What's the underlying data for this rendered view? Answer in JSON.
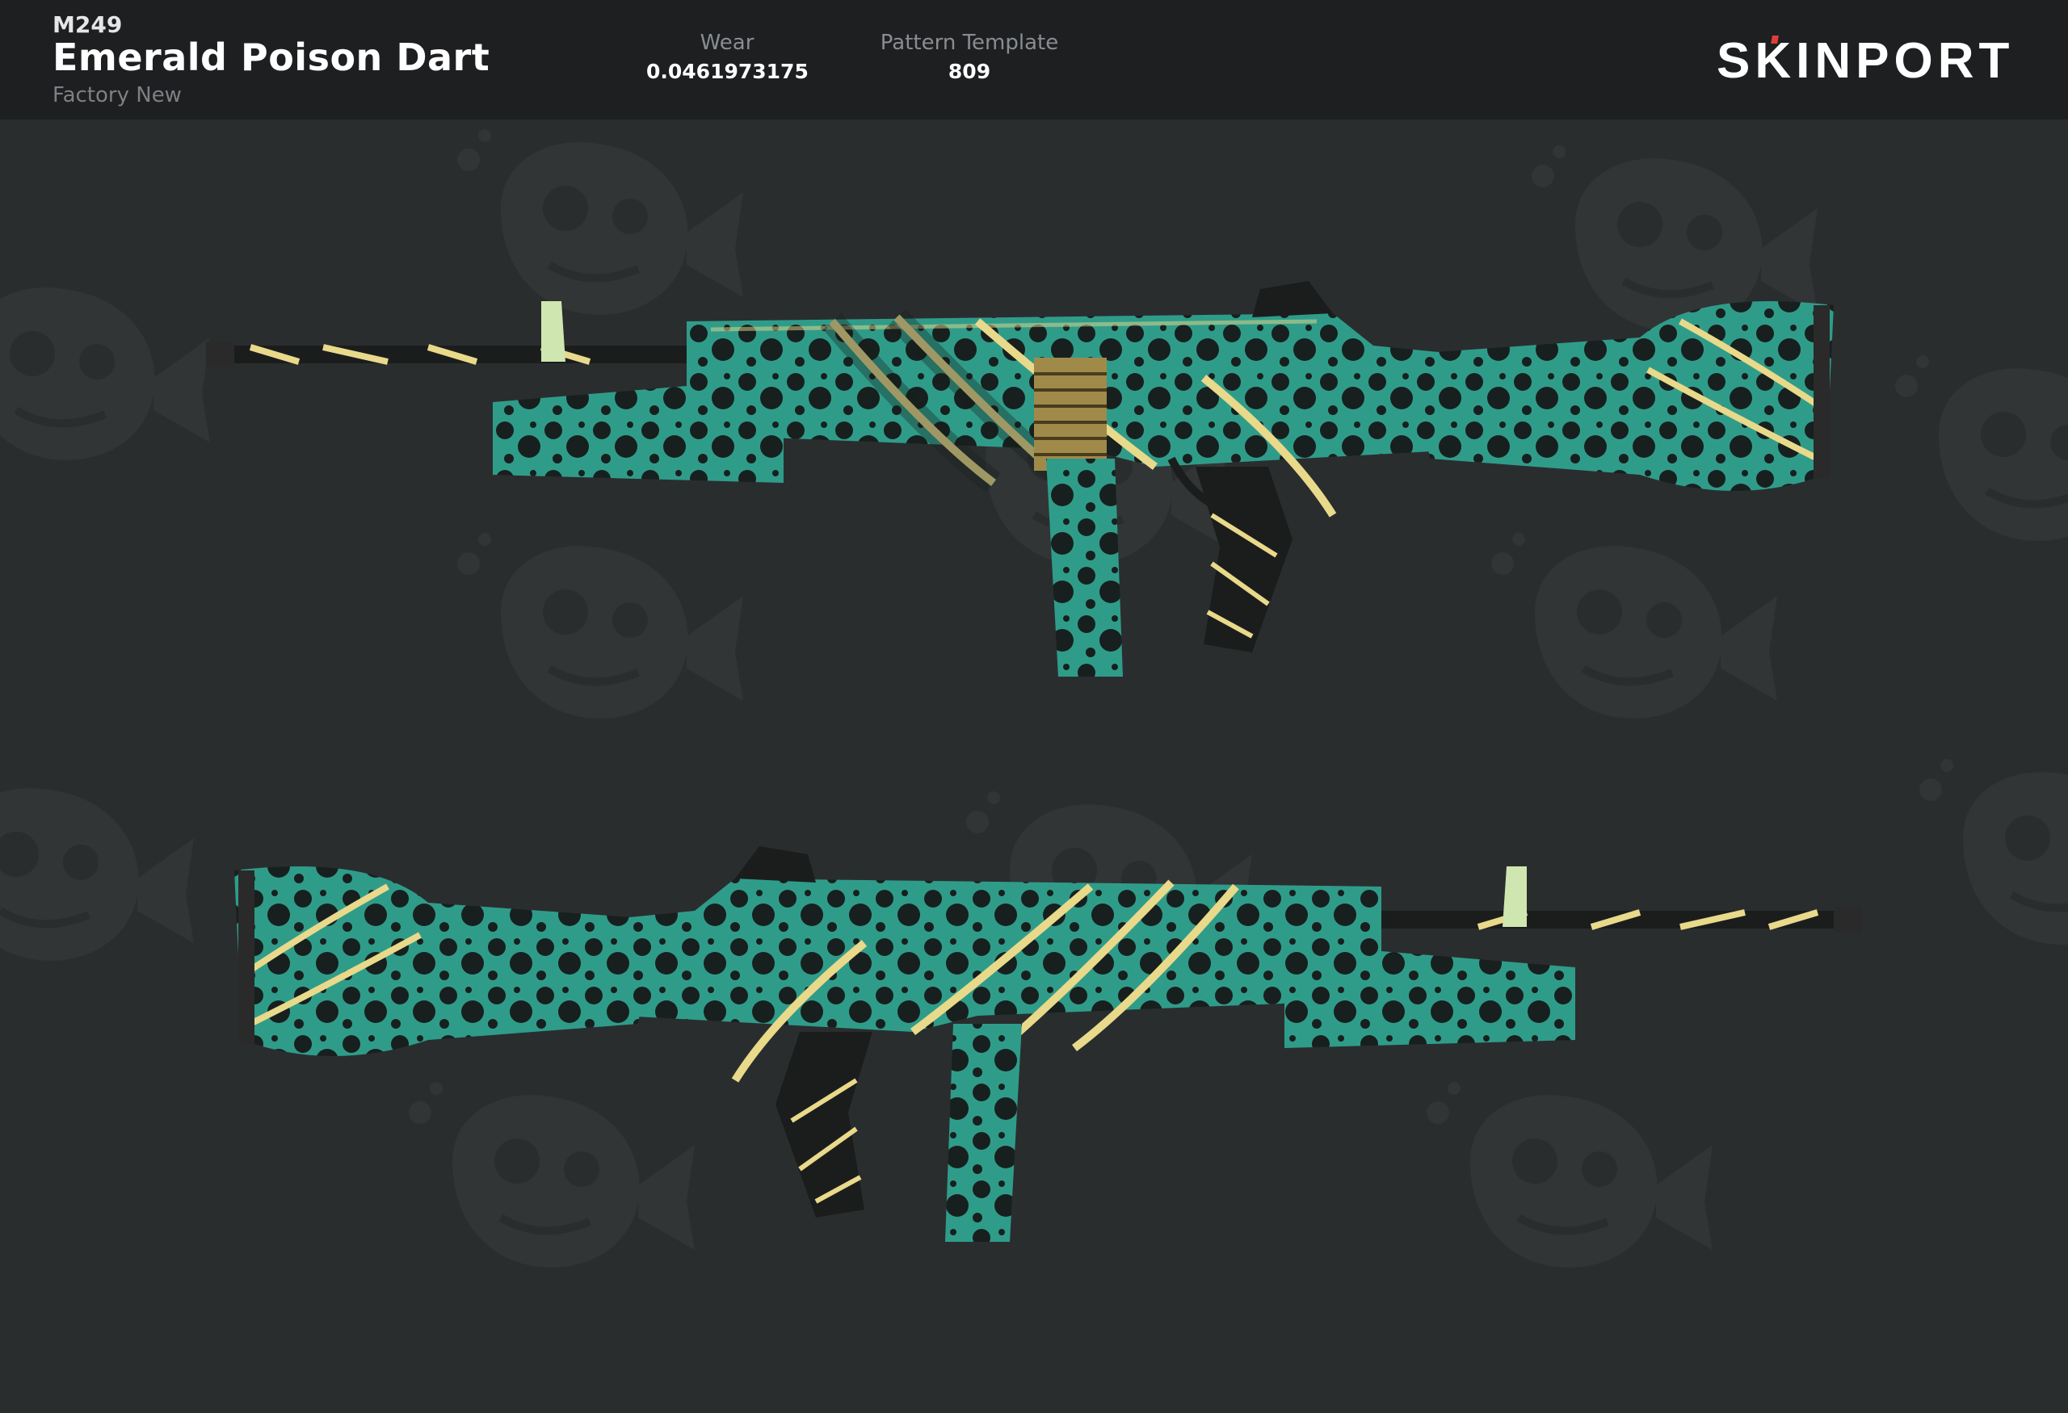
{
  "header": {
    "weapon": "M249",
    "skin_name": "Emerald Poison Dart",
    "exterior": "Factory New",
    "wear": {
      "label": "Wear",
      "value": "0.0461973175"
    },
    "pattern": {
      "label": "Pattern Template",
      "value": "809"
    },
    "logo_text": "SKINPORT"
  },
  "colors": {
    "header_bg": "#1d1f21",
    "stage_bg": "#2a2d2e",
    "logo_accent": "#e23b3b",
    "teal": "#2f9c8a",
    "spot": "#17201e",
    "stripe": "#e9d98a"
  },
  "icons": [
    "skull-fish-pattern",
    "m249-weapon-image"
  ]
}
